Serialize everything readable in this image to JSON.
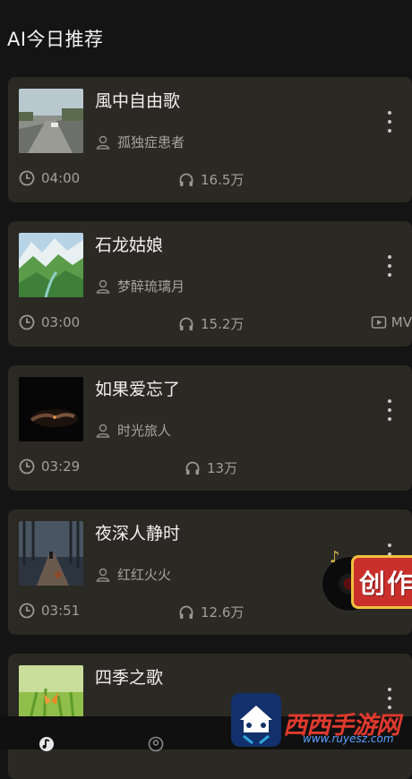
{
  "header": {
    "title": "AI今日推荐"
  },
  "songs": [
    {
      "title": "風中自由歌",
      "artist": "孤独症患者",
      "duration": "04:00",
      "plays": "16.5万",
      "thumbnail": "road-bridge",
      "mv": ""
    },
    {
      "title": "石龙姑娘",
      "artist": "梦醉琉璃月",
      "duration": "03:00",
      "plays": "15.2万",
      "thumbnail": "green-mountains",
      "mv": "MV"
    },
    {
      "title": "如果爱忘了",
      "artist": "时光旅人",
      "duration": "03:29",
      "plays": "13万",
      "thumbnail": "dark-hands",
      "mv": ""
    },
    {
      "title": "夜深人静时",
      "artist": "红红火火",
      "duration": "03:51",
      "plays": "12.6万",
      "thumbnail": "forest-path",
      "mv": ""
    },
    {
      "title": "四季之歌",
      "artist": "",
      "duration": "",
      "plays": "",
      "thumbnail": "butterfly-grass",
      "mv": ""
    }
  ],
  "floating_badge": {
    "label": "创作",
    "icon": "vinyl-record-icon"
  },
  "bottom_nav": {
    "items": [
      "music-note-icon",
      "user-icon"
    ]
  },
  "watermark": {
    "text": "西西手游网",
    "sub": "www.ruyesz.com"
  },
  "colors": {
    "background": "#141414",
    "card": "#2b2923",
    "accent": "#c9302c"
  }
}
